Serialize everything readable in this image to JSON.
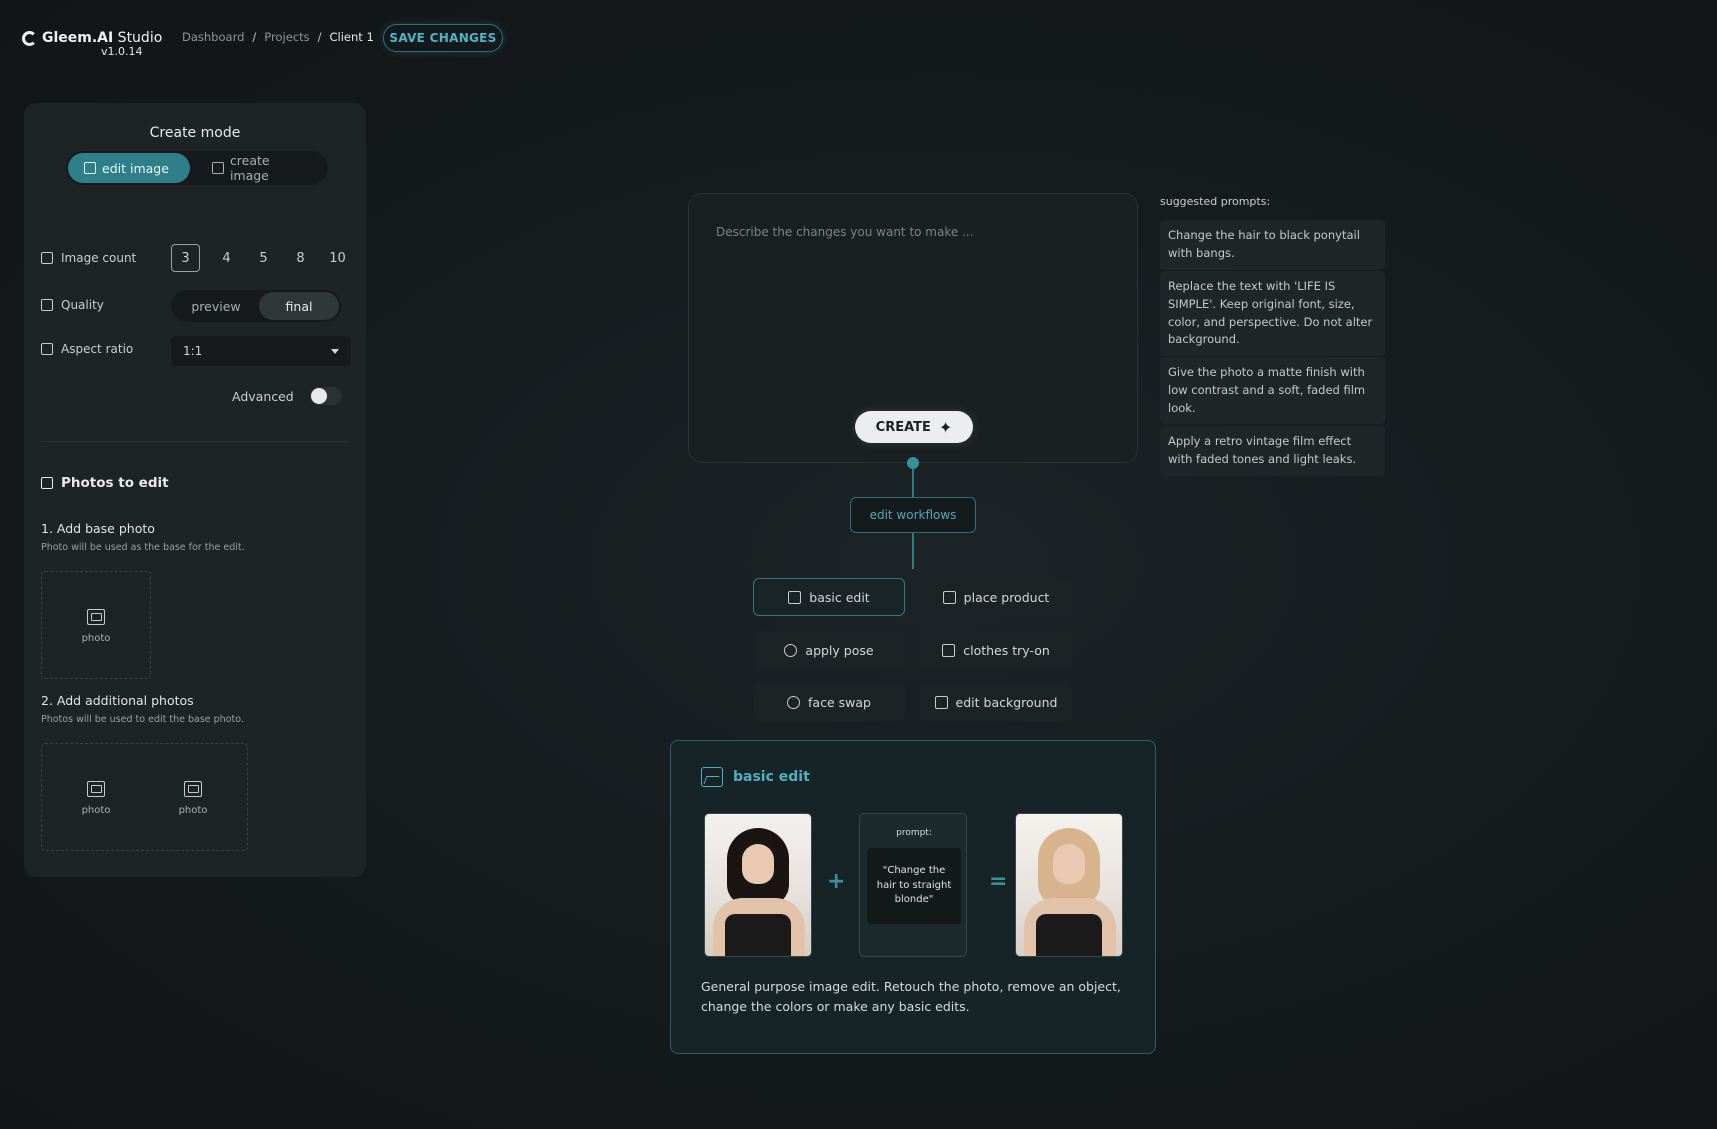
{
  "app": {
    "brand_bold": "Gleem.AI",
    "brand_thin": " Studio",
    "version": "v1.0.14"
  },
  "breadcrumb": [
    "Dashboard",
    "Projects",
    "Client 1"
  ],
  "header": {
    "save_label": "SAVE CHANGES"
  },
  "sidebar": {
    "mode_title": "Create mode",
    "modes": [
      {
        "label": "edit image",
        "active": true
      },
      {
        "label": "create image",
        "active": false
      }
    ],
    "image_count": {
      "label": "Image count",
      "options": [
        "3",
        "4",
        "5",
        "8",
        "10"
      ],
      "selected": "3"
    },
    "quality": {
      "label": "Quality",
      "options": [
        "preview",
        "final"
      ],
      "selected": "final"
    },
    "aspect_ratio": {
      "label": "Aspect ratio",
      "value": "1:1"
    },
    "advanced": {
      "label": "Advanced",
      "on": false
    },
    "photos_title": "Photos to edit",
    "step1": {
      "title": "1. Add base photo",
      "subtitle": "Photo will be used as the base for the edit.",
      "slot_label": "photo"
    },
    "step2": {
      "title": "2. Add additional photos",
      "subtitle": "Photos will be used to edit the base photo.",
      "slot_labels": [
        "photo",
        "photo"
      ]
    }
  },
  "editor": {
    "placeholder": "Describe the changes you want to make ...",
    "create_label": "CREATE",
    "workflows_label": "edit workflows",
    "workflows": [
      {
        "label": "basic edit",
        "icon": "image-icon",
        "active": true
      },
      {
        "label": "place product",
        "icon": "box-icon",
        "active": false
      },
      {
        "label": "apply pose",
        "icon": "pose-icon",
        "active": false
      },
      {
        "label": "clothes try-on",
        "icon": "shirt-icon",
        "active": false
      },
      {
        "label": "face swap",
        "icon": "face-swap-icon",
        "active": false
      },
      {
        "label": "edit background",
        "icon": "background-icon",
        "active": false
      }
    ]
  },
  "preview_card": {
    "title": "basic edit",
    "prompt_label": "prompt:",
    "prompt_text": "\"Change the hair to straight blonde\"",
    "plus": "+",
    "equals": "=",
    "description": "General purpose image edit. Retouch the photo, remove an object, change the colors or make any basic edits."
  },
  "suggestions": {
    "title": "suggested prompts:",
    "items": [
      "Change the hair to black ponytail with bangs.",
      "Replace the text with 'LIFE IS SIMPLE'. Keep original font, size, color, and perspective. Do not alter background.",
      "Give the photo a matte finish with low contrast and a soft, faded film look.",
      "Apply a retro vintage film effect with faded tones and light leaks."
    ]
  },
  "colors": {
    "accent": "#4fb6c8",
    "accent_dark": "#2f7f8a",
    "background": "#151a1c",
    "panel": "#1e2325"
  }
}
